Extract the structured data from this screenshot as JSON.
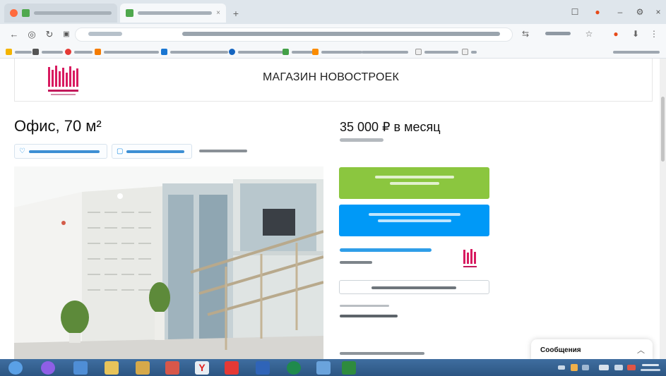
{
  "shop": {
    "name": "МАГАЗИН НОВОСТРОЕК"
  },
  "listing": {
    "title": "Офис, 70 м²",
    "price": "35 000 ₽ в месяц"
  },
  "colors": {
    "show_phone_button": "#8bc63f",
    "write_message_button": "#0099f7",
    "accent_link": "#1c8fe3",
    "taskbar": "#2c5582"
  },
  "icons": {
    "favorite": "heart-icon",
    "note": "note-icon",
    "browser_back": "arrow-left-icon",
    "browser_refresh": "refresh-icon",
    "messenger_toggle": "chevron-up-icon"
  }
}
